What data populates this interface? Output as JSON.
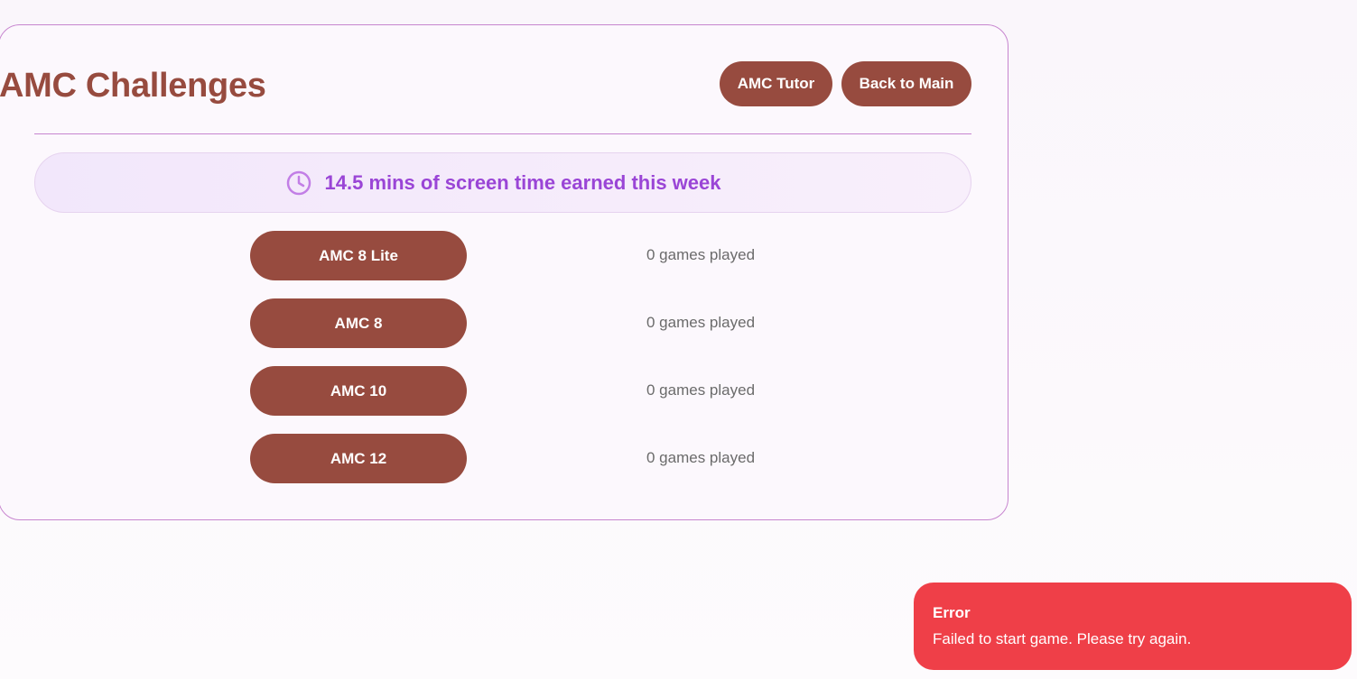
{
  "header": {
    "title": "AMC Challenges",
    "tutor_label": "AMC Tutor",
    "back_label": "Back to Main"
  },
  "screen_time": {
    "icon": "clock-icon",
    "text": "14.5 mins of screen time earned this week"
  },
  "games": [
    {
      "label": "AMC 8 Lite",
      "played": "0 games played"
    },
    {
      "label": "AMC 8",
      "played": "0 games played"
    },
    {
      "label": "AMC 10",
      "played": "0 games played"
    },
    {
      "label": "AMC 12",
      "played": "0 games played"
    }
  ],
  "toast": {
    "title": "Error",
    "message": "Failed to start game. Please try again."
  },
  "colors": {
    "accent": "#974b3f",
    "purple": "#9a45d6",
    "border": "#c785cf",
    "error": "#ef3f48"
  }
}
